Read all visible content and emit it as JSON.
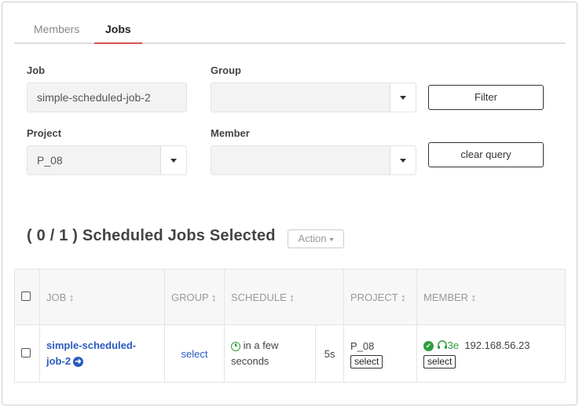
{
  "tabs": [
    {
      "label": "Members"
    },
    {
      "label": "Jobs"
    }
  ],
  "form": {
    "job_label": "Job",
    "job_value": "simple-scheduled-job-2",
    "group_label": "Group",
    "group_value": "",
    "project_label": "Project",
    "project_value": "P_08",
    "member_label": "Member",
    "member_value": "",
    "filter_button": "Filter",
    "clear_button": "clear query"
  },
  "heading": "( 0 / 1 ) Scheduled Jobs Selected",
  "action_button": "Action",
  "table": {
    "headers": {
      "job": "JOB ↕",
      "group": "GROUP ↕",
      "schedule": "SCHEDULE ↕",
      "project": "PROJECT ↕",
      "member": "MEMBER ↕"
    },
    "rows": [
      {
        "job_part1": "simple-scheduled-",
        "job_part2": "job-2",
        "group": "select",
        "schedule_line1": "in a few",
        "schedule_line2": "seconds",
        "interval": "5s",
        "project": "P_08",
        "project_select": "select",
        "member_code": "3e",
        "member_ip": "192.168.56.23",
        "member_select": "select"
      }
    ]
  },
  "icons": {
    "arrow": "arrow-right-circle-icon",
    "clock": "clock-icon",
    "ok": "check-circle-icon",
    "headphone": "headphone-icon"
  },
  "colors": {
    "accent_tab": "#d9534f",
    "link": "#2a5bbf",
    "status_green": "#2e9e3e"
  }
}
